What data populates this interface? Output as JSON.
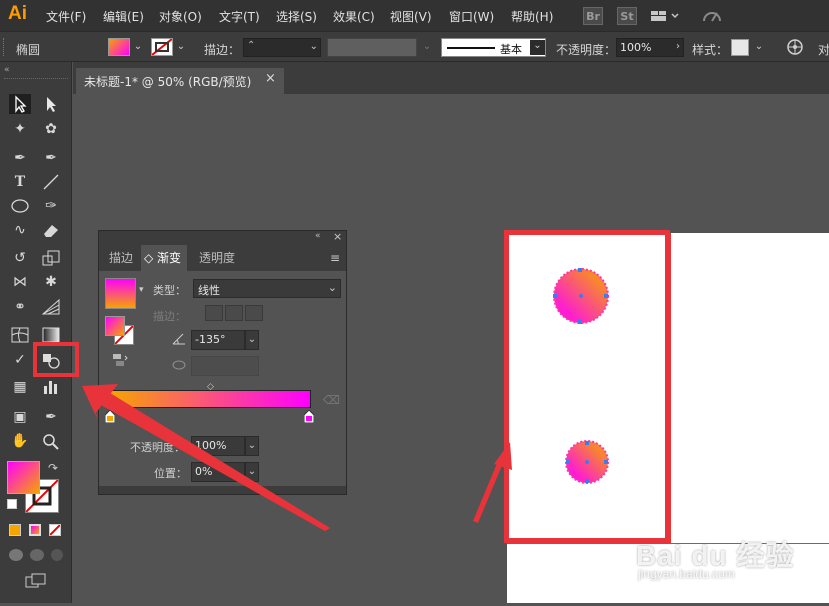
{
  "app": {
    "logo": "Ai"
  },
  "menu": [
    "文件(F)",
    "编辑(E)",
    "对象(O)",
    "文字(T)",
    "选择(S)",
    "效果(C)",
    "视图(V)",
    "窗口(W)",
    "帮助(H)"
  ],
  "menubar_icons": {
    "bridge": "Br",
    "stock": "St"
  },
  "control": {
    "shape_name": "椭圆",
    "stroke_label": "描边：",
    "stroke_style": "基本",
    "opacity_label": "不透明度：",
    "opacity_value": "100%",
    "style_label": "样式：",
    "cut_label": "对"
  },
  "document": {
    "tab_title": "未标题-1* @ 50% (RGB/预览)",
    "close": "×"
  },
  "gradient_panel": {
    "tabs": [
      "描边",
      "◇ 渐变",
      "透明度"
    ],
    "type_label": "类型：",
    "type_value": "线性",
    "stroke_label": "描边：",
    "angle_value": "-135°",
    "opacity_label": "不透明度：",
    "opacity_value": "100%",
    "position_label": "位置：",
    "position_value": "0%",
    "colors": {
      "start": "#f6a400",
      "end": "#ff00ff"
    }
  },
  "colors": {
    "accent_red": "#e8333a",
    "panel_bg": "#535353",
    "ui_dark": "#323232"
  },
  "watermark": {
    "brand": "Bai du 经验",
    "url": "jingyan.baidu.com"
  }
}
